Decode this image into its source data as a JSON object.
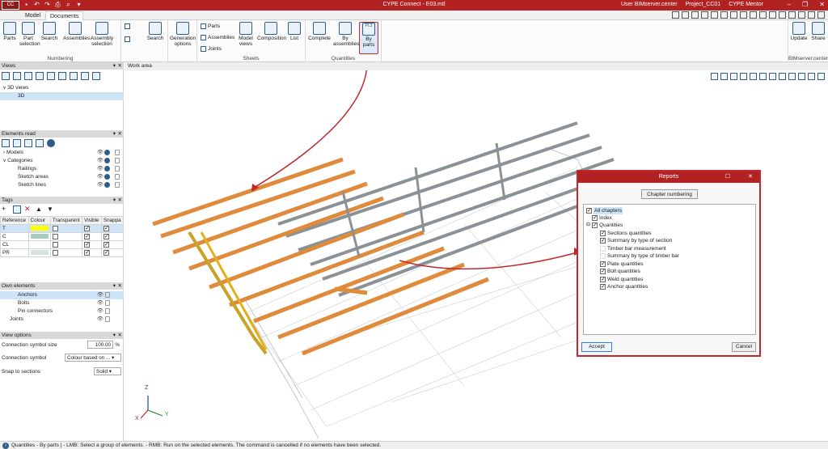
{
  "app": {
    "title": "CYPE Connect - E03.mtl",
    "logo": "CC",
    "user": "User BIMserver.center",
    "project": "Project_CC01",
    "mentor": "CYPE Mentor"
  },
  "tabs": [
    "Model",
    "Documents"
  ],
  "ribbon": {
    "numbering": {
      "label": "Numbering",
      "buttons": [
        "Parts",
        "Part selection",
        "Search",
        "Assemblies",
        "Assembly selection",
        "Search"
      ]
    },
    "generation": {
      "label": "Generation options"
    },
    "sheets": {
      "label": "Sheets",
      "small": [
        "Parts",
        "Assemblies",
        "Joints"
      ],
      "buttons": [
        "Model views",
        "Composition",
        "List"
      ]
    },
    "quantities": {
      "label": "Quantities",
      "buttons": [
        "Complete",
        "By assemblies",
        "By parts"
      ],
      "by_parts_icon": "PL3"
    },
    "bimserver": {
      "label": "BIMserver.center",
      "buttons": [
        "Update",
        "Share"
      ]
    }
  },
  "views_panel": {
    "title": "Views",
    "tree": [
      "3D views",
      "3D"
    ]
  },
  "elements_panel": {
    "title": "Elements read",
    "rows": [
      "Models",
      "Categories",
      "Railings",
      "Sketch areas",
      "Sketch lines"
    ]
  },
  "tags_panel": {
    "title": "Tags",
    "columns": [
      "Reference",
      "Colour",
      "Transparent",
      "Visible",
      "Snappa"
    ],
    "rows": [
      {
        "ref": "T",
        "colour": "#ffff00",
        "transparent": false,
        "visible": true,
        "snap": true
      },
      {
        "ref": "C",
        "colour": "#a7cfc0",
        "transparent": false,
        "visible": true,
        "snap": true
      },
      {
        "ref": "CL",
        "colour": "#ffffff",
        "transparent": false,
        "visible": true,
        "snap": true
      },
      {
        "ref": "PR",
        "colour": "#d5e3e6",
        "transparent": false,
        "visible": true,
        "snap": true
      }
    ]
  },
  "own_elements_panel": {
    "title": "Own elements",
    "rows": [
      "Anchors",
      "Bolts",
      "Pin connectors",
      "Joints"
    ]
  },
  "view_options_panel": {
    "title": "View options",
    "symbol_size_label": "Connection symbol size",
    "symbol_size_value": "100.00",
    "symbol_size_unit": "%",
    "symbol_label": "Connection symbol",
    "symbol_value": "Colour based on ...",
    "snap_label": "Snap to sections",
    "snap_value": "Solid"
  },
  "work_area": {
    "title": "Work area"
  },
  "reports_dialog": {
    "title": "Reports",
    "chapter_button": "Chapter numbering",
    "items": [
      {
        "label": "All chapters",
        "checked": true,
        "level": 0
      },
      {
        "label": "Index",
        "checked": true,
        "level": 1
      },
      {
        "label": "Quantities",
        "checked": true,
        "level": 1
      },
      {
        "label": "Sections quantities",
        "checked": true,
        "level": 2
      },
      {
        "label": "Summary by type of section",
        "checked": true,
        "level": 2
      },
      {
        "label": "Timber bar measurement",
        "checked": false,
        "level": 2
      },
      {
        "label": "Summary by type of timber bar",
        "checked": false,
        "level": 2
      },
      {
        "label": "Plate quantities",
        "checked": true,
        "level": 2
      },
      {
        "label": "Bolt quantities",
        "checked": true,
        "level": 2
      },
      {
        "label": "Weld quantities",
        "checked": true,
        "level": 2
      },
      {
        "label": "Anchor quantities",
        "checked": true,
        "level": 2
      }
    ],
    "accept": "Accept",
    "cancel": "Cancel"
  },
  "axes": {
    "x": "X",
    "y": "Y",
    "z": "Z"
  },
  "status_bar": "Quantities - By parts | - LMB: Select a group of elements. - RMB: Run on the selected elements. The command is cancelled if no elements have been selected."
}
